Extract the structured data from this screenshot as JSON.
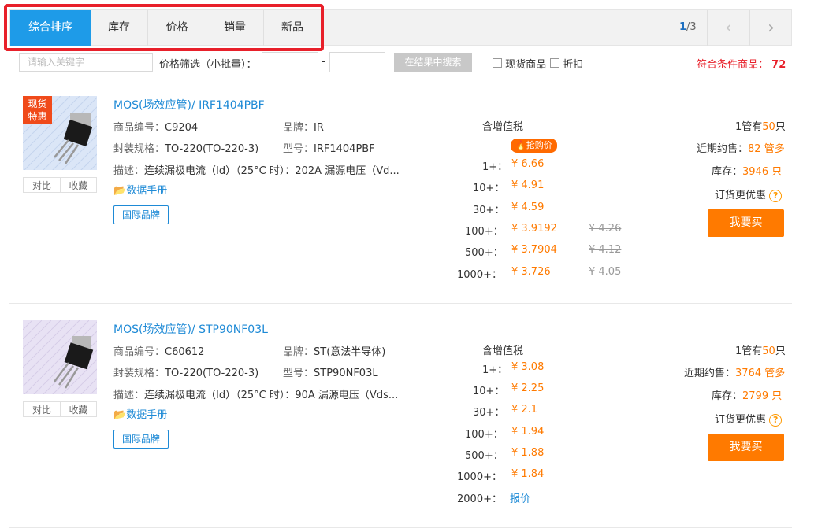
{
  "sort_tabs": [
    "综合排序",
    "库存",
    "价格",
    "销量",
    "新品"
  ],
  "pager": {
    "current": "1",
    "total": "/3"
  },
  "filter": {
    "keyword_placeholder": "请输入关键字",
    "price_label": "价格筛选（小批量）：",
    "dash": "-",
    "search_button": "在结果中搜索",
    "in_stock_label": "现货商品",
    "discount_label": "折扣",
    "result_label": "符合条件商品：",
    "result_count": "72"
  },
  "labels": {
    "code": "商品编号：",
    "brand": "品牌：",
    "package": "封装规格：",
    "model": "型号：",
    "desc": "描述：",
    "datasheet": "数据手册",
    "intl_brand": "国际品牌",
    "compare": "对比",
    "favorite": "收藏",
    "tax": "含增值税",
    "tube_prefix": "1管有",
    "tube_suffix": "只",
    "recent_sales": "近期约售：",
    "stock": "库存：",
    "order_discount": "订货更优惠",
    "buy": "我要买",
    "flash_price": "抢购价",
    "hot_line1": "现货",
    "hot_line2": "特惠"
  },
  "products": [
    {
      "title": "MOS(场效应管)/ IRF1404PBF",
      "code": "C9204",
      "brand": "IR",
      "package": "TO-220(TO-220-3)",
      "model": "IRF1404PBF",
      "desc": "连续漏极电流（Id）（25°C 时）：202A 漏源电压（Vd...",
      "tube_qty": "50",
      "recent_sales": "82 管多",
      "stock": "3946 只",
      "prices": [
        {
          "qty": "1+：",
          "price": "¥ 6.66",
          "old": ""
        },
        {
          "qty": "10+：",
          "price": "¥ 4.91",
          "old": ""
        },
        {
          "qty": "30+：",
          "price": "¥ 4.59",
          "old": ""
        },
        {
          "qty": "100+：",
          "price": "¥ 3.9192",
          "old": "¥ 4.26"
        },
        {
          "qty": "500+：",
          "price": "¥ 3.7904",
          "old": "¥ 4.12"
        },
        {
          "qty": "1000+：",
          "price": "¥ 3.726",
          "old": "¥ 4.05"
        }
      ]
    },
    {
      "title": "MOS(场效应管)/ STP90NF03L",
      "code": "C60612",
      "brand": "ST(意法半导体)",
      "package": "TO-220(TO-220-3)",
      "model": "STP90NF03L",
      "desc": "连续漏极电流（Id）（25°C 时）：90A 漏源电压（Vds...",
      "tube_qty": "50",
      "recent_sales": "3764 管多",
      "stock": "2799 只",
      "prices": [
        {
          "qty": "1+：",
          "price": "¥ 3.08",
          "old": ""
        },
        {
          "qty": "10+：",
          "price": "¥ 2.25",
          "old": ""
        },
        {
          "qty": "30+：",
          "price": "¥ 2.1",
          "old": ""
        },
        {
          "qty": "100+：",
          "price": "¥ 1.94",
          "old": ""
        },
        {
          "qty": "500+：",
          "price": "¥ 1.88",
          "old": ""
        },
        {
          "qty": "1000+：",
          "price": "¥ 1.84",
          "old": ""
        },
        {
          "qty": "2000+：",
          "price": "报价",
          "old": ""
        }
      ]
    }
  ]
}
